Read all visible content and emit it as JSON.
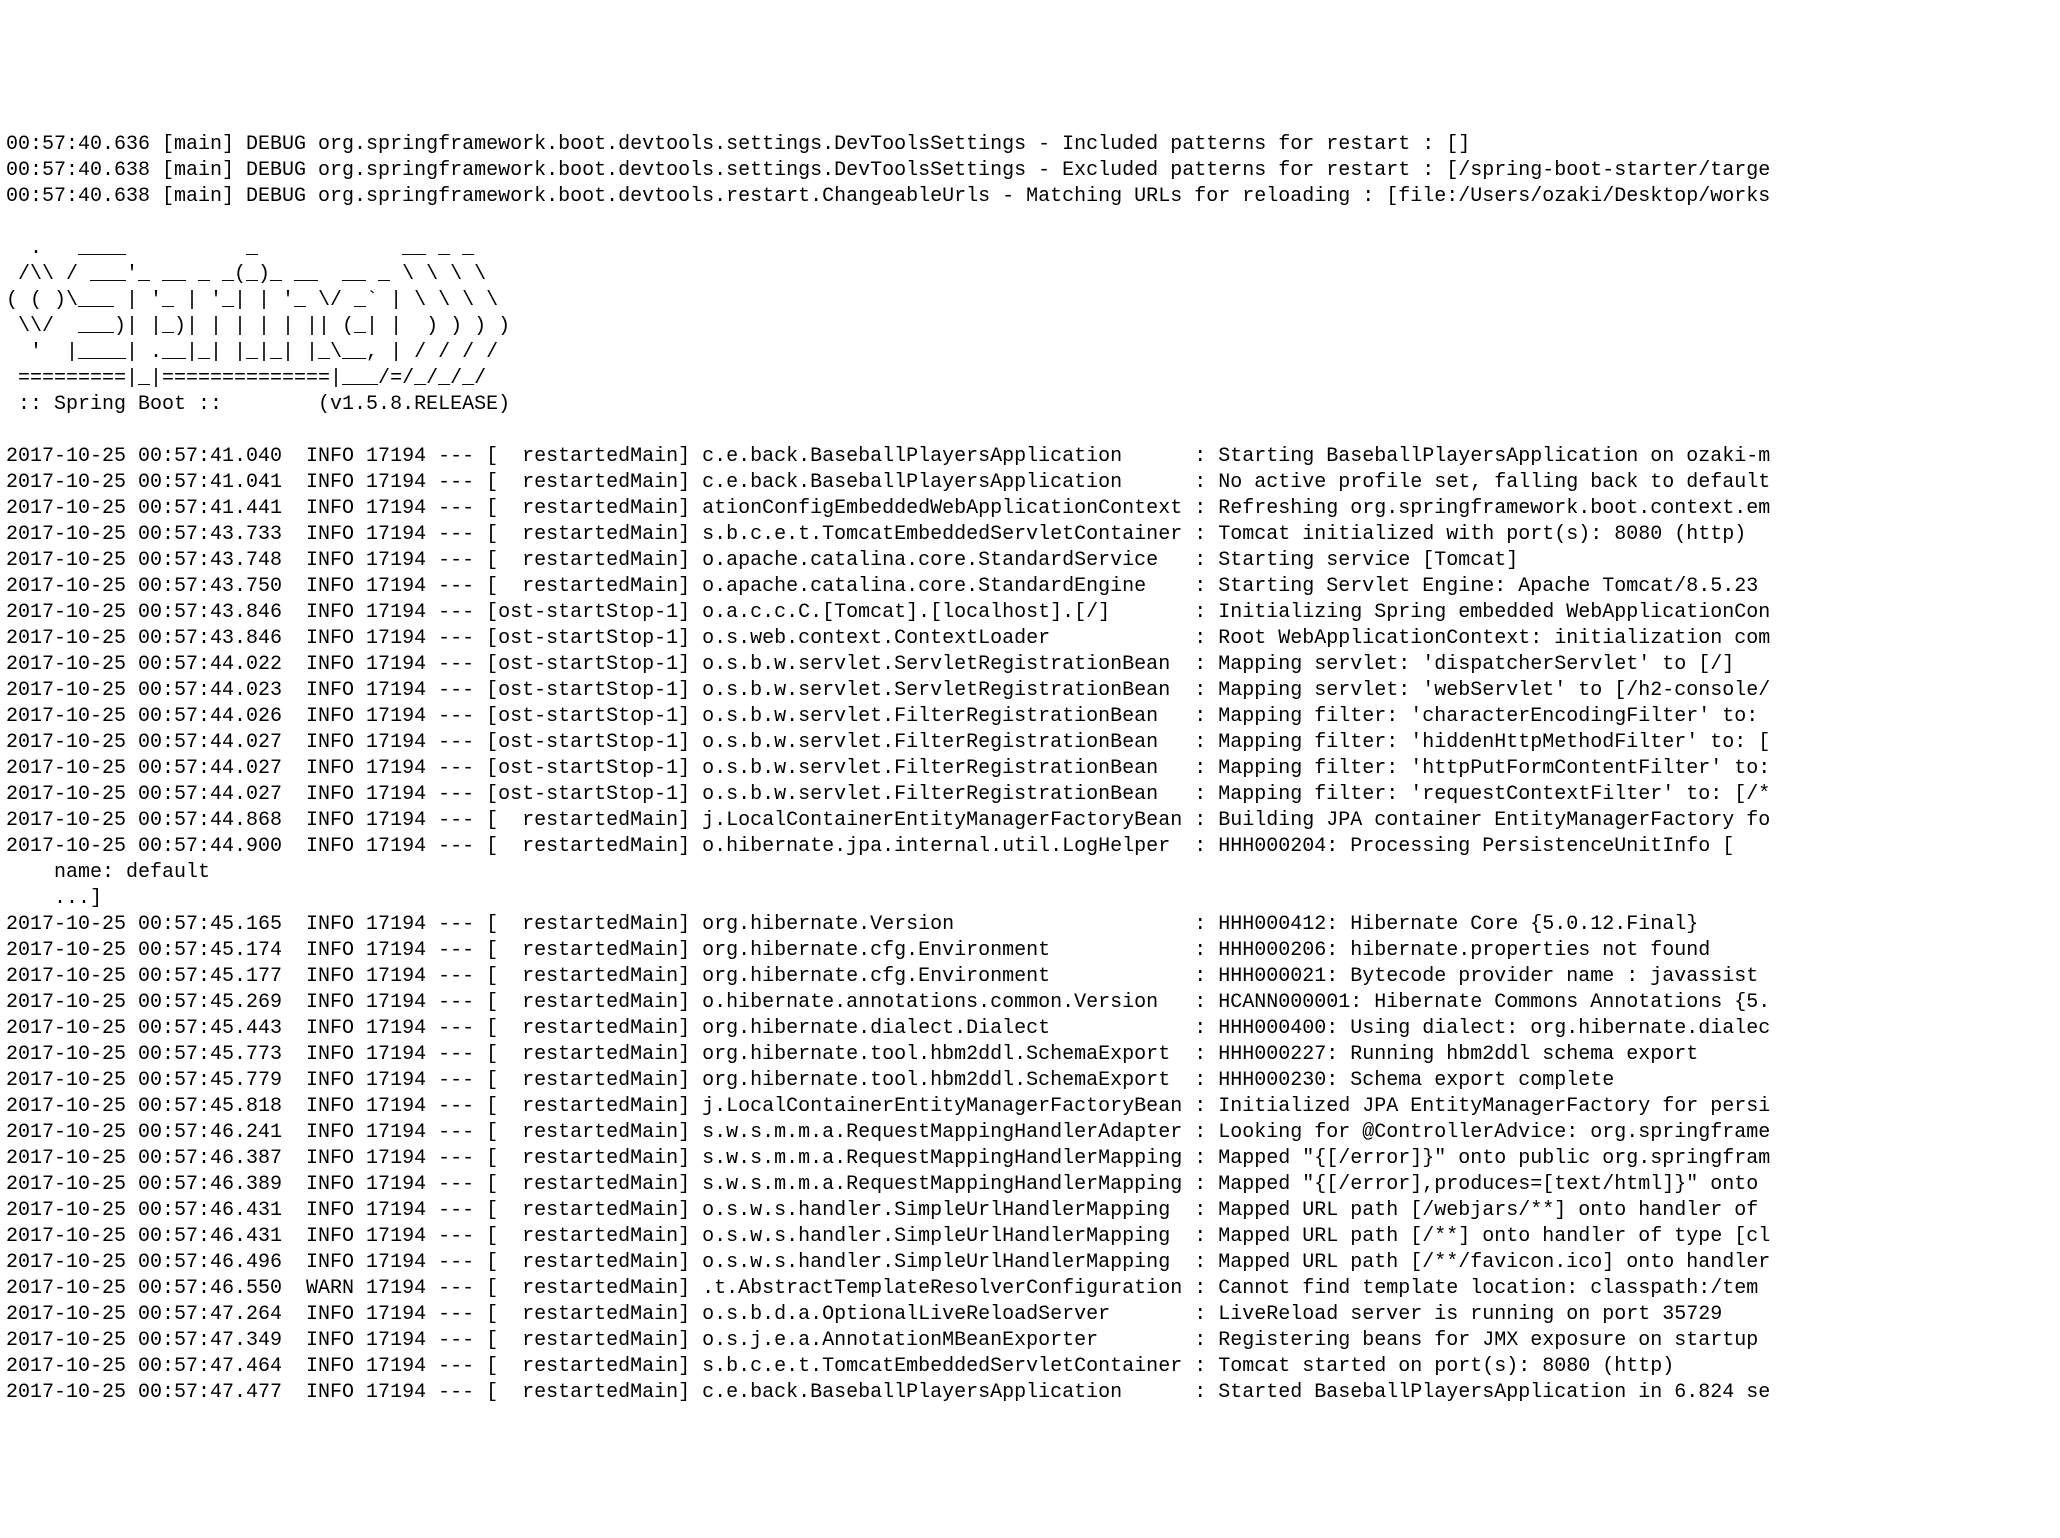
{
  "header_lines": [
    "00:57:40.636 [main] DEBUG org.springframework.boot.devtools.settings.DevToolsSettings - Included patterns for restart : []",
    "00:57:40.638 [main] DEBUG org.springframework.boot.devtools.settings.DevToolsSettings - Excluded patterns for restart : [/spring-boot-starter/targe",
    "00:57:40.638 [main] DEBUG org.springframework.boot.devtools.restart.ChangeableUrls - Matching URLs for reloading : [file:/Users/ozaki/Desktop/works"
  ],
  "banner": [
    "",
    "  .   ____          _            __ _ _",
    " /\\\\ / ___'_ __ _ _(_)_ __  __ _ \\ \\ \\ \\",
    "( ( )\\___ | '_ | '_| | '_ \\/ _` | \\ \\ \\ \\",
    " \\\\/  ___)| |_)| | | | | || (_| |  ) ) ) )",
    "  '  |____| .__|_| |_|_| |_\\__, | / / / /",
    " =========|_|==============|___/=/_/_/_/",
    " :: Spring Boot ::        (v1.5.8.RELEASE)",
    ""
  ],
  "log_lines": [
    "2017-10-25 00:57:41.040  INFO 17194 --- [  restartedMain] c.e.back.BaseballPlayersApplication      : Starting BaseballPlayersApplication on ozaki-m",
    "2017-10-25 00:57:41.041  INFO 17194 --- [  restartedMain] c.e.back.BaseballPlayersApplication      : No active profile set, falling back to default",
    "2017-10-25 00:57:41.441  INFO 17194 --- [  restartedMain] ationConfigEmbeddedWebApplicationContext : Refreshing org.springframework.boot.context.em",
    "2017-10-25 00:57:43.733  INFO 17194 --- [  restartedMain] s.b.c.e.t.TomcatEmbeddedServletContainer : Tomcat initialized with port(s): 8080 (http)",
    "2017-10-25 00:57:43.748  INFO 17194 --- [  restartedMain] o.apache.catalina.core.StandardService   : Starting service [Tomcat]",
    "2017-10-25 00:57:43.750  INFO 17194 --- [  restartedMain] o.apache.catalina.core.StandardEngine    : Starting Servlet Engine: Apache Tomcat/8.5.23",
    "2017-10-25 00:57:43.846  INFO 17194 --- [ost-startStop-1] o.a.c.c.C.[Tomcat].[localhost].[/]       : Initializing Spring embedded WebApplicationCon",
    "2017-10-25 00:57:43.846  INFO 17194 --- [ost-startStop-1] o.s.web.context.ContextLoader            : Root WebApplicationContext: initialization com",
    "2017-10-25 00:57:44.022  INFO 17194 --- [ost-startStop-1] o.s.b.w.servlet.ServletRegistrationBean  : Mapping servlet: 'dispatcherServlet' to [/]",
    "2017-10-25 00:57:44.023  INFO 17194 --- [ost-startStop-1] o.s.b.w.servlet.ServletRegistrationBean  : Mapping servlet: 'webServlet' to [/h2-console/",
    "2017-10-25 00:57:44.026  INFO 17194 --- [ost-startStop-1] o.s.b.w.servlet.FilterRegistrationBean   : Mapping filter: 'characterEncodingFilter' to: ",
    "2017-10-25 00:57:44.027  INFO 17194 --- [ost-startStop-1] o.s.b.w.servlet.FilterRegistrationBean   : Mapping filter: 'hiddenHttpMethodFilter' to: [",
    "2017-10-25 00:57:44.027  INFO 17194 --- [ost-startStop-1] o.s.b.w.servlet.FilterRegistrationBean   : Mapping filter: 'httpPutFormContentFilter' to:",
    "2017-10-25 00:57:44.027  INFO 17194 --- [ost-startStop-1] o.s.b.w.servlet.FilterRegistrationBean   : Mapping filter: 'requestContextFilter' to: [/*",
    "2017-10-25 00:57:44.868  INFO 17194 --- [  restartedMain] j.LocalContainerEntityManagerFactoryBean : Building JPA container EntityManagerFactory fo",
    "2017-10-25 00:57:44.900  INFO 17194 --- [  restartedMain] o.hibernate.jpa.internal.util.LogHelper  : HHH000204: Processing PersistenceUnitInfo [",
    "    name: default",
    "    ...]",
    "2017-10-25 00:57:45.165  INFO 17194 --- [  restartedMain] org.hibernate.Version                    : HHH000412: Hibernate Core {5.0.12.Final}",
    "2017-10-25 00:57:45.174  INFO 17194 --- [  restartedMain] org.hibernate.cfg.Environment            : HHH000206: hibernate.properties not found",
    "2017-10-25 00:57:45.177  INFO 17194 --- [  restartedMain] org.hibernate.cfg.Environment            : HHH000021: Bytecode provider name : javassist",
    "2017-10-25 00:57:45.269  INFO 17194 --- [  restartedMain] o.hibernate.annotations.common.Version   : HCANN000001: Hibernate Commons Annotations {5.",
    "2017-10-25 00:57:45.443  INFO 17194 --- [  restartedMain] org.hibernate.dialect.Dialect            : HHH000400: Using dialect: org.hibernate.dialec",
    "2017-10-25 00:57:45.773  INFO 17194 --- [  restartedMain] org.hibernate.tool.hbm2ddl.SchemaExport  : HHH000227: Running hbm2ddl schema export",
    "2017-10-25 00:57:45.779  INFO 17194 --- [  restartedMain] org.hibernate.tool.hbm2ddl.SchemaExport  : HHH000230: Schema export complete",
    "2017-10-25 00:57:45.818  INFO 17194 --- [  restartedMain] j.LocalContainerEntityManagerFactoryBean : Initialized JPA EntityManagerFactory for persi",
    "2017-10-25 00:57:46.241  INFO 17194 --- [  restartedMain] s.w.s.m.m.a.RequestMappingHandlerAdapter : Looking for @ControllerAdvice: org.springframe",
    "2017-10-25 00:57:46.387  INFO 17194 --- [  restartedMain] s.w.s.m.m.a.RequestMappingHandlerMapping : Mapped \"{[/error]}\" onto public org.springfram",
    "2017-10-25 00:57:46.389  INFO 17194 --- [  restartedMain] s.w.s.m.m.a.RequestMappingHandlerMapping : Mapped \"{[/error],produces=[text/html]}\" onto ",
    "2017-10-25 00:57:46.431  INFO 17194 --- [  restartedMain] o.s.w.s.handler.SimpleUrlHandlerMapping  : Mapped URL path [/webjars/**] onto handler of ",
    "2017-10-25 00:57:46.431  INFO 17194 --- [  restartedMain] o.s.w.s.handler.SimpleUrlHandlerMapping  : Mapped URL path [/**] onto handler of type [cl",
    "2017-10-25 00:57:46.496  INFO 17194 --- [  restartedMain] o.s.w.s.handler.SimpleUrlHandlerMapping  : Mapped URL path [/**/favicon.ico] onto handler",
    "2017-10-25 00:57:46.550  WARN 17194 --- [  restartedMain] .t.AbstractTemplateResolverConfiguration : Cannot find template location: classpath:/tem",
    "2017-10-25 00:57:47.264  INFO 17194 --- [  restartedMain] o.s.b.d.a.OptionalLiveReloadServer       : LiveReload server is running on port 35729",
    "2017-10-25 00:57:47.349  INFO 17194 --- [  restartedMain] o.s.j.e.a.AnnotationMBeanExporter        : Registering beans for JMX exposure on startup",
    "2017-10-25 00:57:47.464  INFO 17194 --- [  restartedMain] s.b.c.e.t.TomcatEmbeddedServletContainer : Tomcat started on port(s): 8080 (http)",
    "2017-10-25 00:57:47.477  INFO 17194 --- [  restartedMain] c.e.back.BaseballPlayersApplication      : Started BaseballPlayersApplication in 6.824 se"
  ]
}
